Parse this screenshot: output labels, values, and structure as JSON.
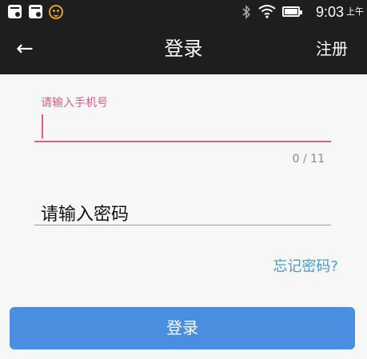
{
  "status_bar": {
    "time": "9:03",
    "ampm": "上午",
    "icons": [
      "notification-icon",
      "notification-icon",
      "face-icon",
      "bluetooth-icon",
      "wifi-icon",
      "battery-icon"
    ]
  },
  "header": {
    "back_icon": "←",
    "title": "登录",
    "register_label": "注册"
  },
  "phone_field": {
    "floating_label": "请输入手机号",
    "value": "",
    "counter": "0 / 11"
  },
  "password_field": {
    "placeholder": "请输入密码"
  },
  "forgot_link": "忘记密码?",
  "login_button": "登录",
  "colors": {
    "bar": "#1e1e1e",
    "accent_pink": "#e05c8a",
    "link_blue": "#3e9fd4",
    "button_blue": "#4a8ee0"
  }
}
